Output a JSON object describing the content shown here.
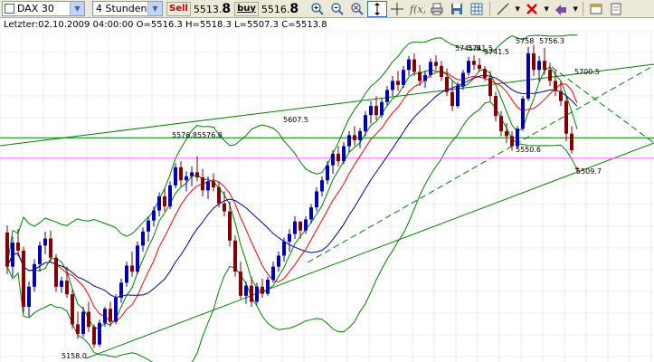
{
  "toolbar": {
    "instrument": "DAX 30",
    "timeframe": "4 Stunden",
    "sell_label": "Sell",
    "sell_price_main": "5513.",
    "sell_price_big": "8",
    "buy_label": "buy",
    "buy_price_main": "5516.",
    "buy_price_big": "8",
    "tool_icons": [
      "zoom-in-icon",
      "zoom-out-icon",
      "zoom-fit-icon",
      "cursor-icon",
      "crosshair-icon",
      "function-icon",
      "print-icon",
      "save-icon",
      "grid-icon",
      "trendline-icon",
      "delete-icon",
      "arrows-icon",
      "properties-icon",
      "info-icon"
    ]
  },
  "status": {
    "text": "Letzter:02.10.2009 04:00:00 O=5516.3 H=5518.3 L=5507.3 C=5513.8"
  },
  "chart_data": {
    "type": "candlestick",
    "y_range": [
      5130,
      5790
    ],
    "candles": [
      [
        5388,
        5402,
        5305,
        5320
      ],
      [
        5320,
        5380,
        5300,
        5368
      ],
      [
        5368,
        5395,
        5340,
        5352
      ],
      [
        5352,
        5360,
        5228,
        5240
      ],
      [
        5240,
        5290,
        5220,
        5280
      ],
      [
        5280,
        5335,
        5270,
        5325
      ],
      [
        5325,
        5370,
        5310,
        5362
      ],
      [
        5362,
        5390,
        5345,
        5376
      ],
      [
        5376,
        5392,
        5330,
        5338
      ],
      [
        5338,
        5345,
        5270,
        5280
      ],
      [
        5280,
        5300,
        5268,
        5292
      ],
      [
        5292,
        5320,
        5258,
        5265
      ],
      [
        5265,
        5275,
        5196,
        5205
      ],
      [
        5205,
        5230,
        5176,
        5186
      ],
      [
        5186,
        5240,
        5180,
        5230
      ],
      [
        5230,
        5250,
        5190,
        5200
      ],
      [
        5200,
        5205,
        5158,
        5165
      ],
      [
        5165,
        5215,
        5160,
        5208
      ],
      [
        5208,
        5240,
        5200,
        5236
      ],
      [
        5236,
        5250,
        5200,
        5210
      ],
      [
        5210,
        5265,
        5205,
        5258
      ],
      [
        5258,
        5296,
        5248,
        5288
      ],
      [
        5288,
        5330,
        5280,
        5322
      ],
      [
        5322,
        5350,
        5300,
        5310
      ],
      [
        5310,
        5370,
        5305,
        5362
      ],
      [
        5362,
        5398,
        5350,
        5390
      ],
      [
        5390,
        5420,
        5370,
        5412
      ],
      [
        5412,
        5440,
        5400,
        5432
      ],
      [
        5432,
        5468,
        5420,
        5460
      ],
      [
        5460,
        5475,
        5430,
        5440
      ],
      [
        5440,
        5490,
        5435,
        5482
      ],
      [
        5482,
        5526,
        5476,
        5518
      ],
      [
        5518,
        5530,
        5480,
        5492
      ],
      [
        5492,
        5510,
        5470,
        5500
      ],
      [
        5500,
        5520,
        5480,
        5508
      ],
      [
        5508,
        5540,
        5490,
        5498
      ],
      [
        5498,
        5515,
        5460,
        5472
      ],
      [
        5472,
        5500,
        5455,
        5490
      ],
      [
        5490,
        5506,
        5470,
        5478
      ],
      [
        5478,
        5490,
        5438,
        5446
      ],
      [
        5446,
        5470,
        5420,
        5430
      ],
      [
        5430,
        5450,
        5360,
        5372
      ],
      [
        5372,
        5382,
        5300,
        5310
      ],
      [
        5310,
        5330,
        5256,
        5262
      ],
      [
        5262,
        5290,
        5246,
        5282
      ],
      [
        5282,
        5300,
        5240,
        5250
      ],
      [
        5250,
        5288,
        5244,
        5280
      ],
      [
        5280,
        5296,
        5258,
        5266
      ],
      [
        5266,
        5300,
        5262,
        5294
      ],
      [
        5294,
        5330,
        5288,
        5320
      ],
      [
        5320,
        5350,
        5310,
        5342
      ],
      [
        5342,
        5378,
        5330,
        5370
      ],
      [
        5370,
        5395,
        5350,
        5385
      ],
      [
        5385,
        5420,
        5375,
        5410
      ],
      [
        5410,
        5405,
        5376,
        5392
      ],
      [
        5392,
        5420,
        5385,
        5414
      ],
      [
        5414,
        5445,
        5406,
        5438
      ],
      [
        5438,
        5478,
        5430,
        5470
      ],
      [
        5470,
        5500,
        5460,
        5492
      ],
      [
        5492,
        5530,
        5484,
        5522
      ],
      [
        5522,
        5552,
        5505,
        5545
      ],
      [
        5545,
        5560,
        5520,
        5530
      ],
      [
        5530,
        5568,
        5524,
        5560
      ],
      [
        5560,
        5590,
        5548,
        5582
      ],
      [
        5582,
        5600,
        5560,
        5572
      ],
      [
        5572,
        5596,
        5556,
        5590
      ],
      [
        5590,
        5630,
        5580,
        5622
      ],
      [
        5622,
        5650,
        5605,
        5640
      ],
      [
        5640,
        5660,
        5612,
        5622
      ],
      [
        5622,
        5655,
        5616,
        5648
      ],
      [
        5648,
        5680,
        5640,
        5672
      ],
      [
        5672,
        5700,
        5660,
        5690
      ],
      [
        5690,
        5710,
        5670,
        5682
      ],
      [
        5682,
        5720,
        5676,
        5712
      ],
      [
        5712,
        5740,
        5700,
        5733
      ],
      [
        5733,
        5745,
        5700,
        5708
      ],
      [
        5708,
        5722,
        5680,
        5690
      ],
      [
        5690,
        5710,
        5676,
        5702
      ],
      [
        5702,
        5735,
        5696,
        5728
      ],
      [
        5728,
        5741,
        5712,
        5720
      ],
      [
        5720,
        5730,
        5690,
        5698
      ],
      [
        5698,
        5715,
        5660,
        5668
      ],
      [
        5668,
        5690,
        5630,
        5640
      ],
      [
        5640,
        5688,
        5636,
        5680
      ],
      [
        5680,
        5712,
        5672,
        5706
      ],
      [
        5706,
        5738,
        5700,
        5730
      ],
      [
        5730,
        5741,
        5712,
        5722
      ],
      [
        5722,
        5736,
        5708,
        5714
      ],
      [
        5714,
        5720,
        5690,
        5696
      ],
      [
        5696,
        5710,
        5650,
        5660
      ],
      [
        5660,
        5668,
        5610,
        5620
      ],
      [
        5620,
        5630,
        5580,
        5590
      ],
      [
        5590,
        5606,
        5566,
        5580
      ],
      [
        5580,
        5590,
        5551,
        5560
      ],
      [
        5560,
        5600,
        5555,
        5595
      ],
      [
        5595,
        5660,
        5590,
        5655
      ],
      [
        5655,
        5758,
        5650,
        5745
      ],
      [
        5745,
        5762,
        5700,
        5712
      ],
      [
        5712,
        5740,
        5690,
        5730
      ],
      [
        5730,
        5756,
        5702,
        5712
      ],
      [
        5712,
        5726,
        5680,
        5690
      ],
      [
        5690,
        5712,
        5660,
        5670
      ],
      [
        5670,
        5690,
        5640,
        5650
      ],
      [
        5650,
        5660,
        5570,
        5585
      ],
      [
        5585,
        5600,
        5545,
        5552
      ],
      [
        5516.3,
        5518.3,
        5507.3,
        5513.8
      ]
    ],
    "moving_averages": [
      {
        "name": "",
        "period": 5,
        "color": "#008000"
      },
      {
        "name": "",
        "period": 9,
        "color": "#ff0000"
      },
      {
        "name": "",
        "period": 18,
        "color": "#0000a0"
      }
    ],
    "bollinger": {
      "period": 20,
      "color": "#008000"
    },
    "horizontal_lines": [
      {
        "value": 5576.8,
        "color": "#008000"
      },
      {
        "value": 5536,
        "color": "#ff66ff"
      }
    ],
    "annotations": [
      {
        "text": "5158.0",
        "value": 5158.0
      },
      {
        "text": "5576.8",
        "value": 5576.8
      },
      {
        "text": "5576.8",
        "value": 5576.8
      },
      {
        "text": "5607.5",
        "value": 5607.5
      },
      {
        "text": "5741.5",
        "value": 5741.5
      },
      {
        "text": "5741.5",
        "value": 5741.5
      },
      {
        "text": "5758",
        "value": 5758
      },
      {
        "text": "5756.3",
        "value": 5756.3
      },
      {
        "text": "5700.5",
        "value": 5700.5
      },
      {
        "text": "5550.6",
        "value": 5550.6
      },
      {
        "text": "5509.7",
        "value": 5509.7
      },
      {
        "text": "5741.5",
        "value": 5741.5
      }
    ]
  }
}
